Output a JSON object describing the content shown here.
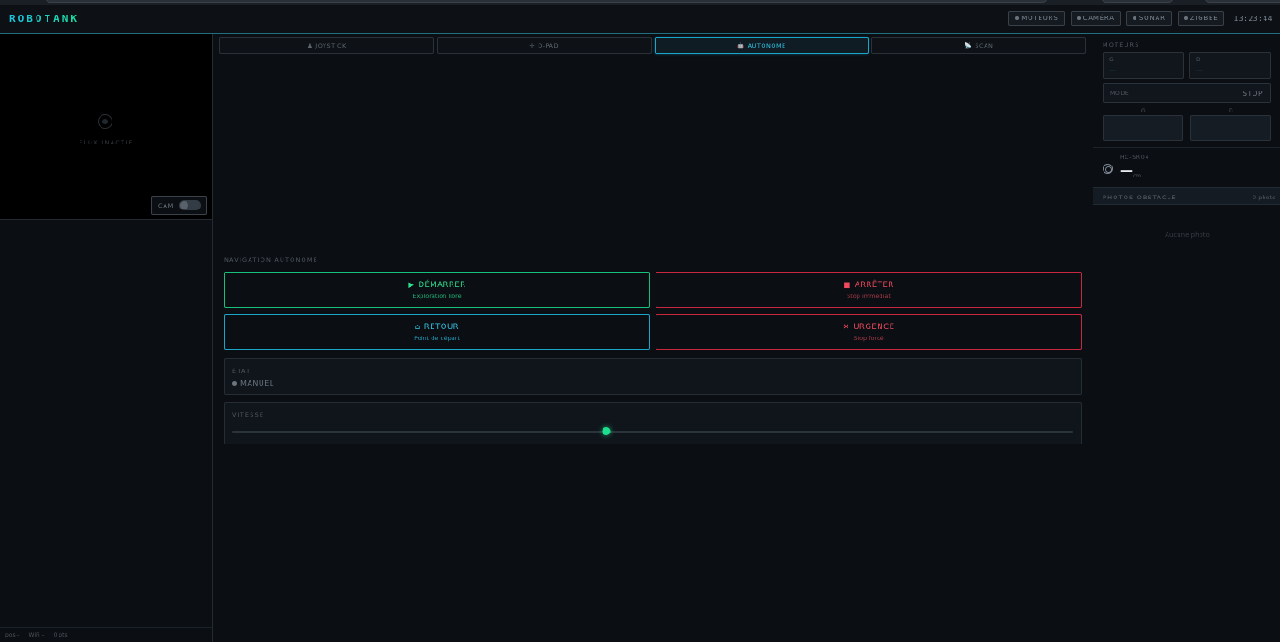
{
  "header": {
    "logo": "ROBOTANK",
    "status_badges": [
      {
        "label": "MOTEURS"
      },
      {
        "label": "CAMÉRA"
      },
      {
        "label": "SONAR"
      },
      {
        "label": "ZIGBEE"
      }
    ],
    "clock": "13:23:44"
  },
  "camera": {
    "flux_text": "FLUX INACTIF",
    "toggle_label": "CAM",
    "toggle_on": false
  },
  "left_footer": {
    "pos": "pos –",
    "wifi": "WiFi –",
    "pts": "0 pts"
  },
  "tabs": [
    {
      "icon": "♟",
      "label": "JOYSTICK",
      "active": false
    },
    {
      "icon": "✛",
      "label": "D-PAD",
      "active": false
    },
    {
      "icon": "🤖",
      "label": "AUTONOME",
      "active": true
    },
    {
      "icon": "📡",
      "label": "SCAN",
      "active": false
    }
  ],
  "autonomous": {
    "section_label": "NAVIGATION AUTONOME",
    "buttons": {
      "start": {
        "icon": "▶",
        "title": "DÉMARRER",
        "sub": "Exploration libre"
      },
      "stop": {
        "icon": "■",
        "title": "ARRÊTER",
        "sub": "Stop immédiat"
      },
      "home": {
        "icon": "⌂",
        "title": "RETOUR",
        "sub": "Point de départ"
      },
      "urgent": {
        "icon": "✕",
        "title": "URGENCE",
        "sub": "Stop forcé"
      }
    },
    "state": {
      "label": "ÉTAT",
      "value": "MANUEL"
    },
    "speed": {
      "label": "VITESSE",
      "value_fraction": 0.445
    }
  },
  "motors": {
    "label": "MOTEURS",
    "left": {
      "label": "G",
      "value": "—"
    },
    "right": {
      "label": "D",
      "value": "—"
    },
    "mode_label": "MODE",
    "mode_value": "STOP",
    "bar_left_label": "G",
    "bar_right_label": "D"
  },
  "sonar": {
    "name": "HC-SR04",
    "value": "—",
    "unit": "cm"
  },
  "photos": {
    "title": "PHOTOS OBSTACLE",
    "count": "0 photo",
    "empty": "Aucune photo"
  },
  "colors": {
    "accent": "#1aa6c8",
    "green": "#17c07a",
    "red": "#c8283f",
    "background": "#0b0e12"
  }
}
